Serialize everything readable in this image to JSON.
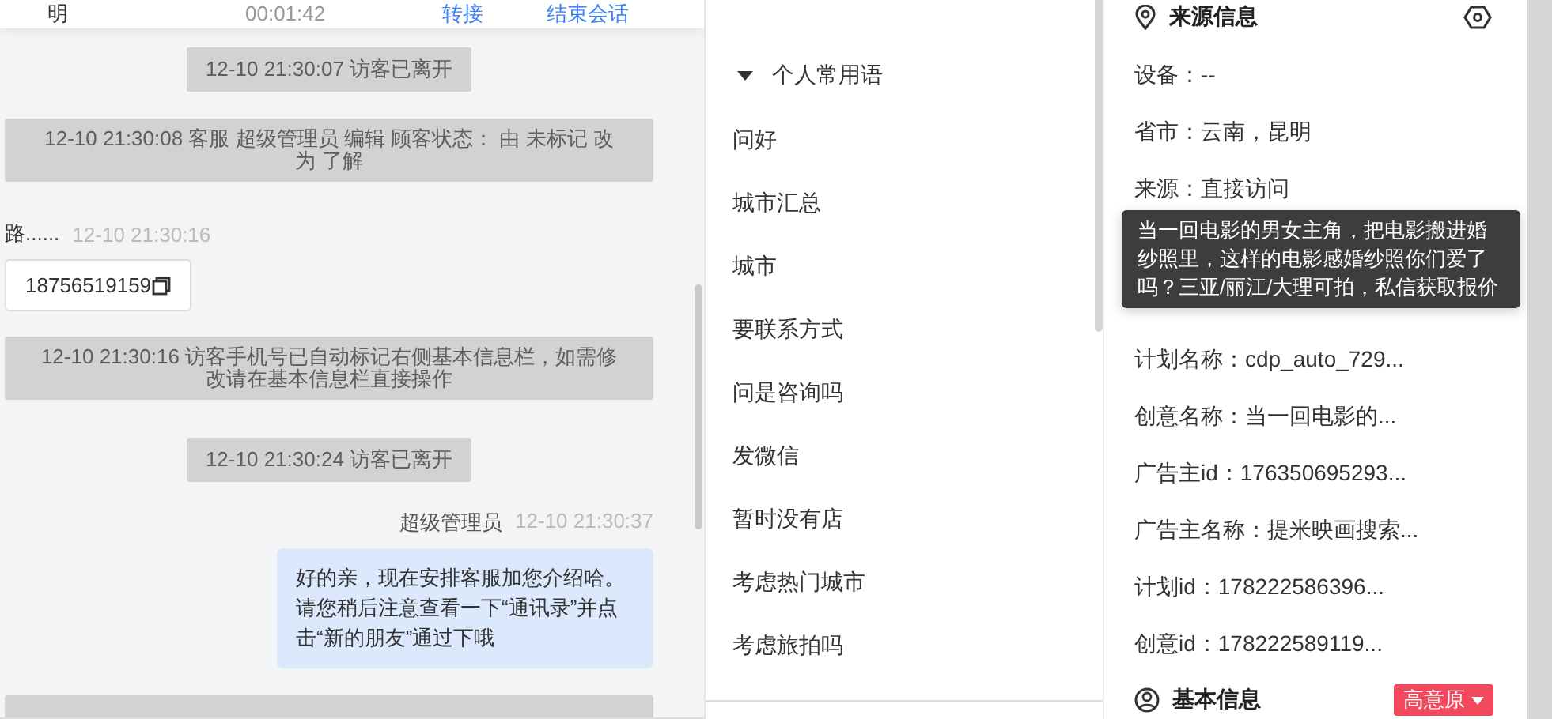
{
  "chat": {
    "header": {
      "name": "明",
      "duration": "00:01:42",
      "actions": [
        "转接",
        "结束会话"
      ]
    },
    "messages": [
      {
        "kind": "system_pill",
        "text": "12-10 21:30:07 访客已离开"
      },
      {
        "kind": "system_block",
        "text": "12-10 21:30:08 客服 超级管理员 编辑 顾客状态： 由 未标记 改为 了解"
      },
      {
        "kind": "visitor",
        "sender": "路......",
        "time": "12-10 21:30:16"
      },
      {
        "kind": "phone",
        "text": "18756519159"
      },
      {
        "kind": "system_block",
        "text": "12-10 21:30:16 访客手机号已自动标记右侧基本信息栏，如需修改请在基本信息栏直接操作"
      },
      {
        "kind": "system_pill",
        "text": "12-10 21:30:24 访客已离开"
      },
      {
        "kind": "agent",
        "sender": "超级管理员",
        "time": "12-10 21:30:37",
        "text": "好的亲，现在安排客服加您介绍哈。请您稍后注意查看一下“通讯录”并点击“新的朋友”通过下哦"
      },
      {
        "kind": "system_cut"
      }
    ]
  },
  "phrases": {
    "group": {
      "title": "个人常用语",
      "expanded": true
    },
    "items": [
      "问好",
      "城市汇总",
      "城市",
      "要联系方式",
      "问是咨询吗",
      "发微信",
      "暂时没有店",
      "考虑热门城市",
      "考虑旅拍吗"
    ]
  },
  "source_info": {
    "title": "来源信息",
    "rows": [
      "设备：--",
      "省市：云南，昆明",
      "来源：直接访问",
      null,
      null,
      "计划名称：cdp_auto_729...",
      "创意名称：当一回电影的...",
      "广告主id：176350695293...",
      "广告主名称：提米映画搜索...",
      "计划id：178222586396...",
      "创意id：178222589119..."
    ],
    "tooltip": "当一回电影的男女主角，把电影搬进婚纱照里，这样的电影感婚纱照你们爱了吗？三亚/丽江/大理可拍，私信获取报价"
  },
  "basic_info": {
    "title": "基本信息",
    "badge": "高意原"
  }
}
